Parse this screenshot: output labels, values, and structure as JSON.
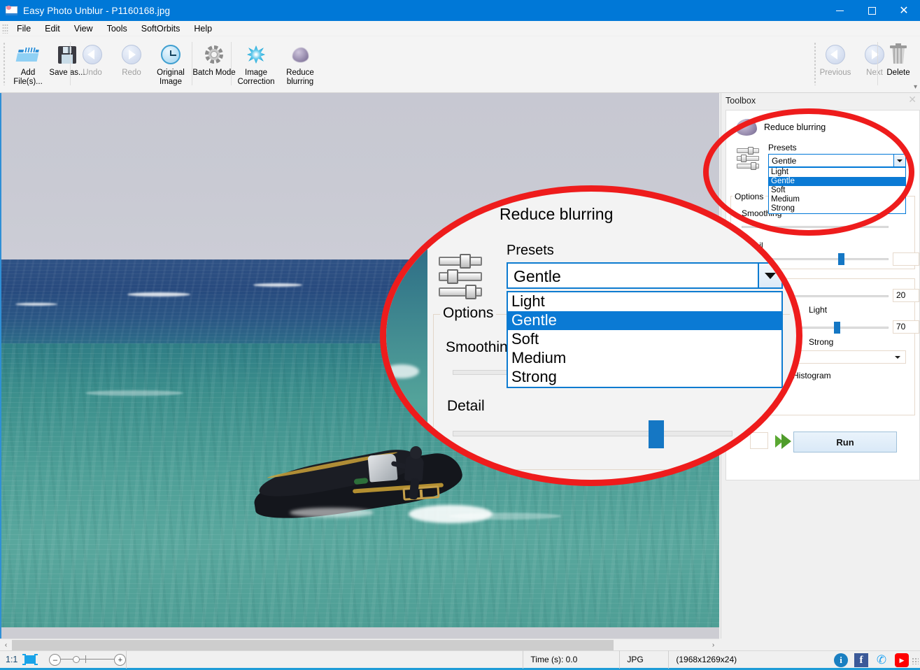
{
  "window": {
    "title": "Easy Photo Unblur - P1160168.jpg",
    "icon": "app-photo-icon",
    "controls": {
      "minimize": "–",
      "maximize": "□",
      "close": "✕"
    }
  },
  "menubar": {
    "items": [
      {
        "label": "File"
      },
      {
        "label": "Edit"
      },
      {
        "label": "View"
      },
      {
        "label": "Tools"
      },
      {
        "label": "SoftOrbits"
      },
      {
        "label": "Help"
      }
    ]
  },
  "toolbar": {
    "buttons": [
      {
        "label": "Add\nFile(s)...",
        "icon": "open-folder-icon",
        "disabled": false
      },
      {
        "label": "Save\nas...",
        "icon": "floppy-disk-icon",
        "disabled": false
      },
      {
        "label": "Undo",
        "icon": "arrow-left-circle-icon",
        "disabled": true
      },
      {
        "label": "Redo",
        "icon": "arrow-right-circle-icon",
        "disabled": true
      },
      {
        "label": "Original\nImage",
        "icon": "clock-history-icon",
        "disabled": false
      },
      {
        "label": "Batch\nMode",
        "icon": "gear-icon",
        "disabled": false
      },
      {
        "label": "Image\nCorrection",
        "icon": "starburst-icon",
        "disabled": false
      },
      {
        "label": "Reduce\nblurring",
        "icon": "blur-blob-icon",
        "disabled": false
      }
    ],
    "right_buttons": [
      {
        "label": "Previous",
        "icon": "arrow-left-circle-icon",
        "disabled": true
      },
      {
        "label": "Next",
        "icon": "arrow-right-circle-icon",
        "disabled": true
      },
      {
        "label": "Delete",
        "icon": "trash-icon",
        "disabled": false
      }
    ],
    "overflow": "▾"
  },
  "toolbox": {
    "panel_title": "Toolbox",
    "close_glyph": "✕",
    "tool_title": "Reduce blurring",
    "presets_label": "Presets",
    "presets_value": "Gentle",
    "presets_options": [
      "Light",
      "Gentle",
      "Soft",
      "Medium",
      "Strong"
    ],
    "presets_selected_index": 1,
    "options_group_label": "Options",
    "smoothing_label": "Smoothing",
    "detail_label": "Detail",
    "detail_value": "",
    "second_group_label": "",
    "light_label": "Light",
    "strong_label": "Strong",
    "value_top": "20",
    "value_bottom": "70",
    "histogram_label": "Histogram",
    "run_label": "Run"
  },
  "magnifier": {
    "title": "Reduce blurring",
    "presets_label": "Presets",
    "combo_value": "Gentle",
    "options": [
      "Light",
      "Gentle",
      "Soft",
      "Medium",
      "Strong"
    ],
    "selected_index": 1,
    "options_label": "Options",
    "smoothing_label": "Smoothing",
    "detail_label": "Detail"
  },
  "statusbar": {
    "zoom_ratio": "1:1",
    "fit_icon": "fit-to-screen-icon",
    "zoom_out": "–",
    "zoom_in": "+",
    "time": "Time (s): 0.0",
    "format": "JPG",
    "dimensions": "(1968x1269x24)",
    "social": [
      {
        "name": "info-icon",
        "glyph": "i"
      },
      {
        "name": "facebook-icon",
        "glyph": "f"
      },
      {
        "name": "twitter-icon",
        "glyph": "✆"
      },
      {
        "name": "youtube-icon",
        "glyph": "▶"
      }
    ]
  },
  "scrollbar": {
    "left_arrow": "‹",
    "right_arrow": "›"
  },
  "colors": {
    "accent": "#0078d7",
    "title_bar": "#0078d7",
    "highlight": "#0b7ad4",
    "annotation_red": "#ee1c1c",
    "slider_thumb": "#1577c4",
    "status_underline": "#1e9cd7"
  }
}
